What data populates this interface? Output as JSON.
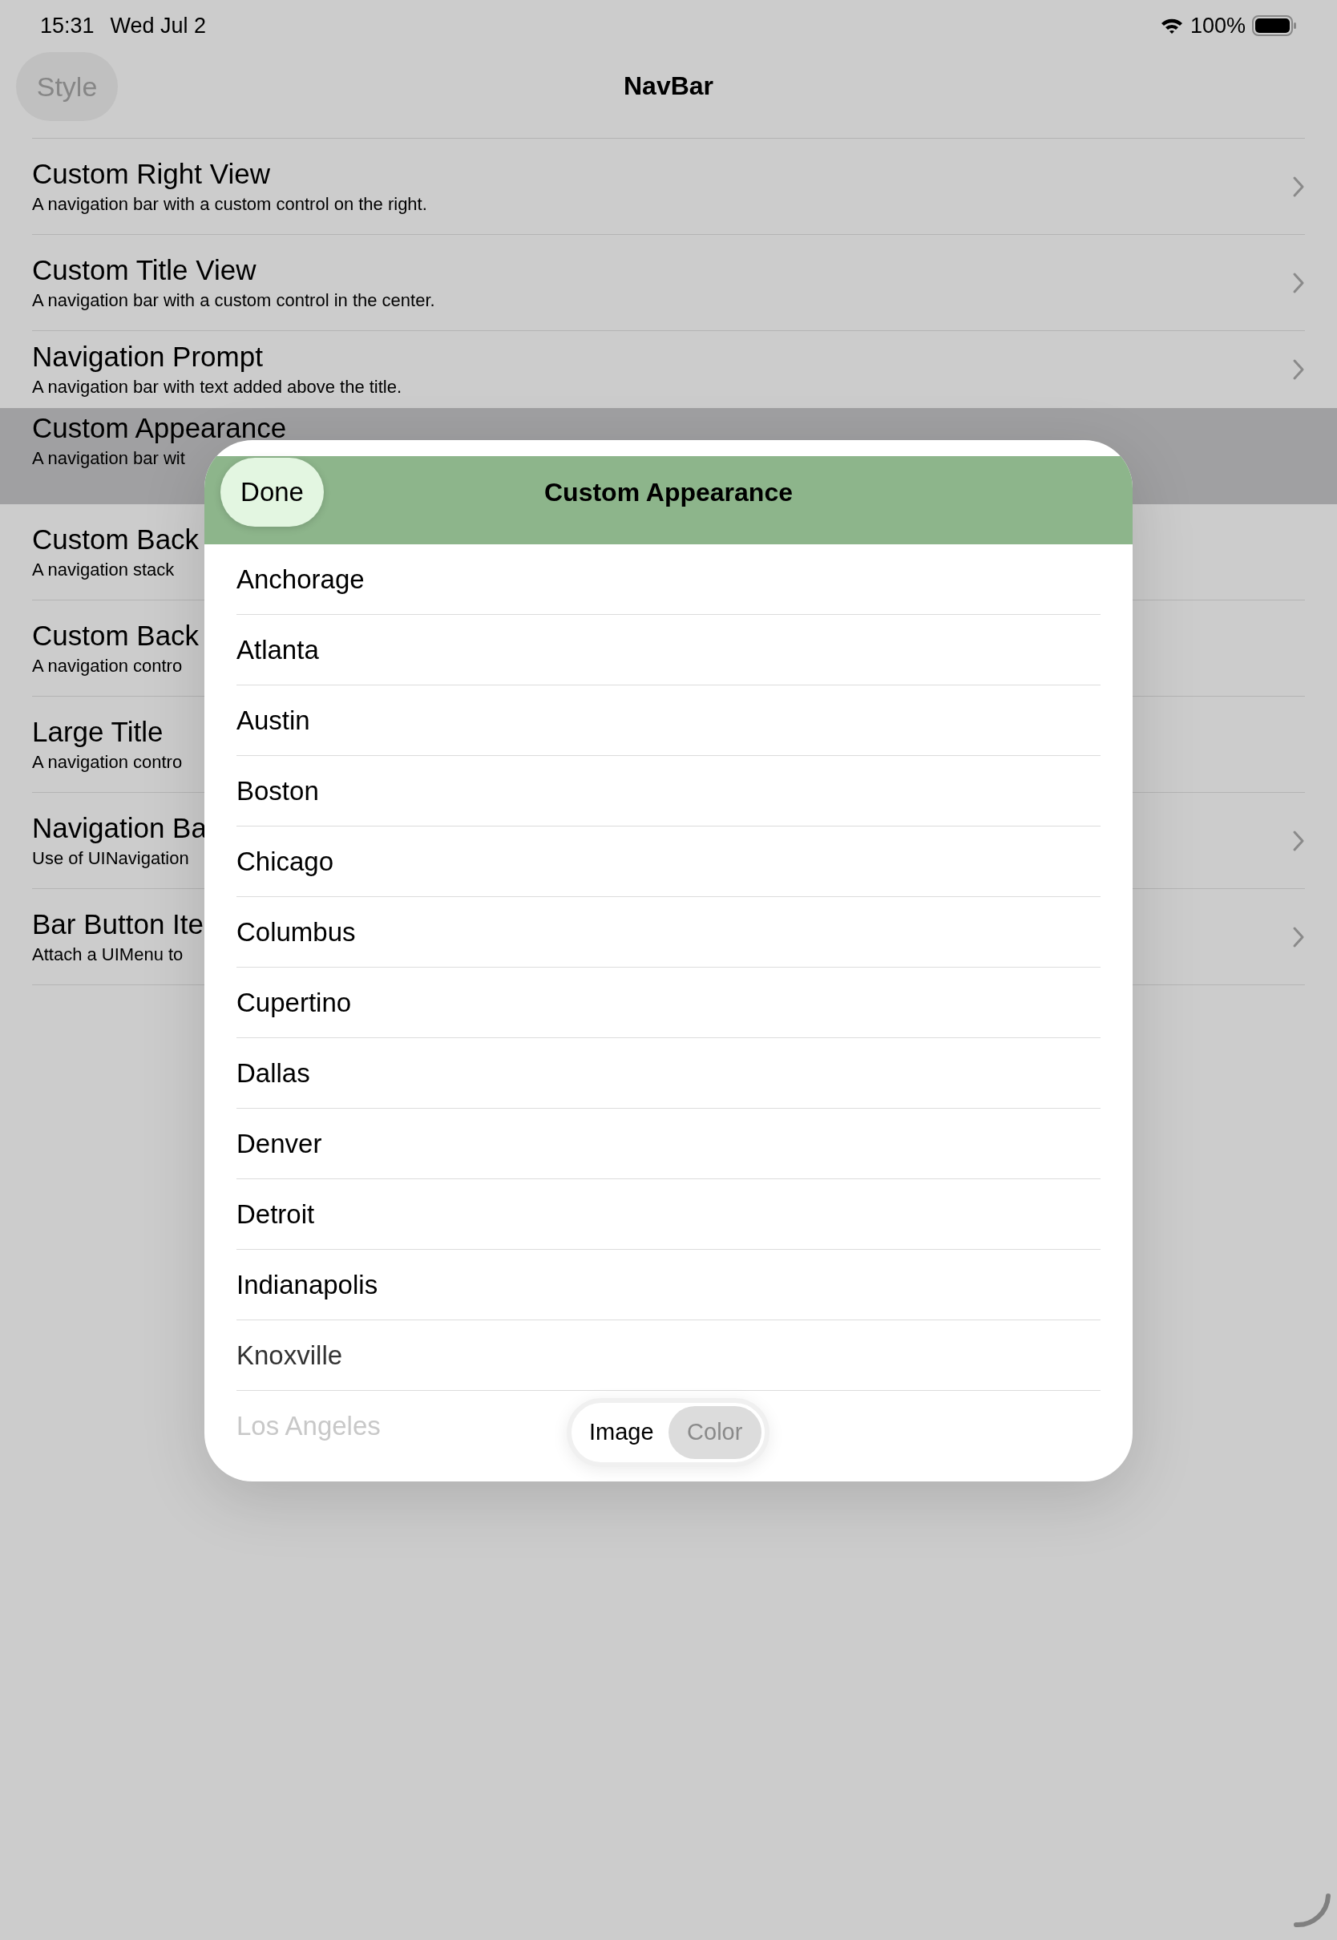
{
  "status_bar": {
    "time": "15:31",
    "date": "Wed Jul 2",
    "battery": "100%"
  },
  "nav_bar": {
    "style_button": "Style",
    "title": "NavBar"
  },
  "list": [
    {
      "title": "Custom Right View",
      "subtitle": "A navigation bar with a custom control on the right.",
      "disclosure": true,
      "selected": false
    },
    {
      "title": "Custom Title View",
      "subtitle": "A navigation bar with a custom control in the center.",
      "disclosure": true,
      "selected": false
    },
    {
      "title": "Navigation Prompt",
      "subtitle": "A navigation bar with text added above the title.",
      "disclosure": true,
      "selected": false
    },
    {
      "title": "Custom Appearance",
      "subtitle": "A navigation bar wit",
      "disclosure": false,
      "selected": true
    },
    {
      "title": "Custom Back",
      "subtitle": "A navigation stack",
      "disclosure": false,
      "selected": false
    },
    {
      "title": "Custom Back",
      "subtitle": "A navigation contro",
      "disclosure": false,
      "selected": false
    },
    {
      "title": "Large Title",
      "subtitle": "A navigation contro",
      "disclosure": false,
      "selected": false
    },
    {
      "title": "Navigation Ba",
      "subtitle": "Use of UINavigation",
      "disclosure": true,
      "selected": false
    },
    {
      "title": "Bar Button Ite",
      "subtitle": "Attach a UIMenu to",
      "disclosure": true,
      "selected": false
    }
  ],
  "sheet": {
    "done_button": "Done",
    "title": "Custom Appearance",
    "cities": [
      "Anchorage",
      "Atlanta",
      "Austin",
      "Boston",
      "Chicago",
      "Columbus",
      "Cupertino",
      "Dallas",
      "Denver",
      "Detroit",
      "Indianapolis",
      "Knoxville",
      "Los Angeles"
    ],
    "segments": [
      {
        "label": "Image",
        "selected": false
      },
      {
        "label": "Color",
        "selected": true
      }
    ]
  }
}
